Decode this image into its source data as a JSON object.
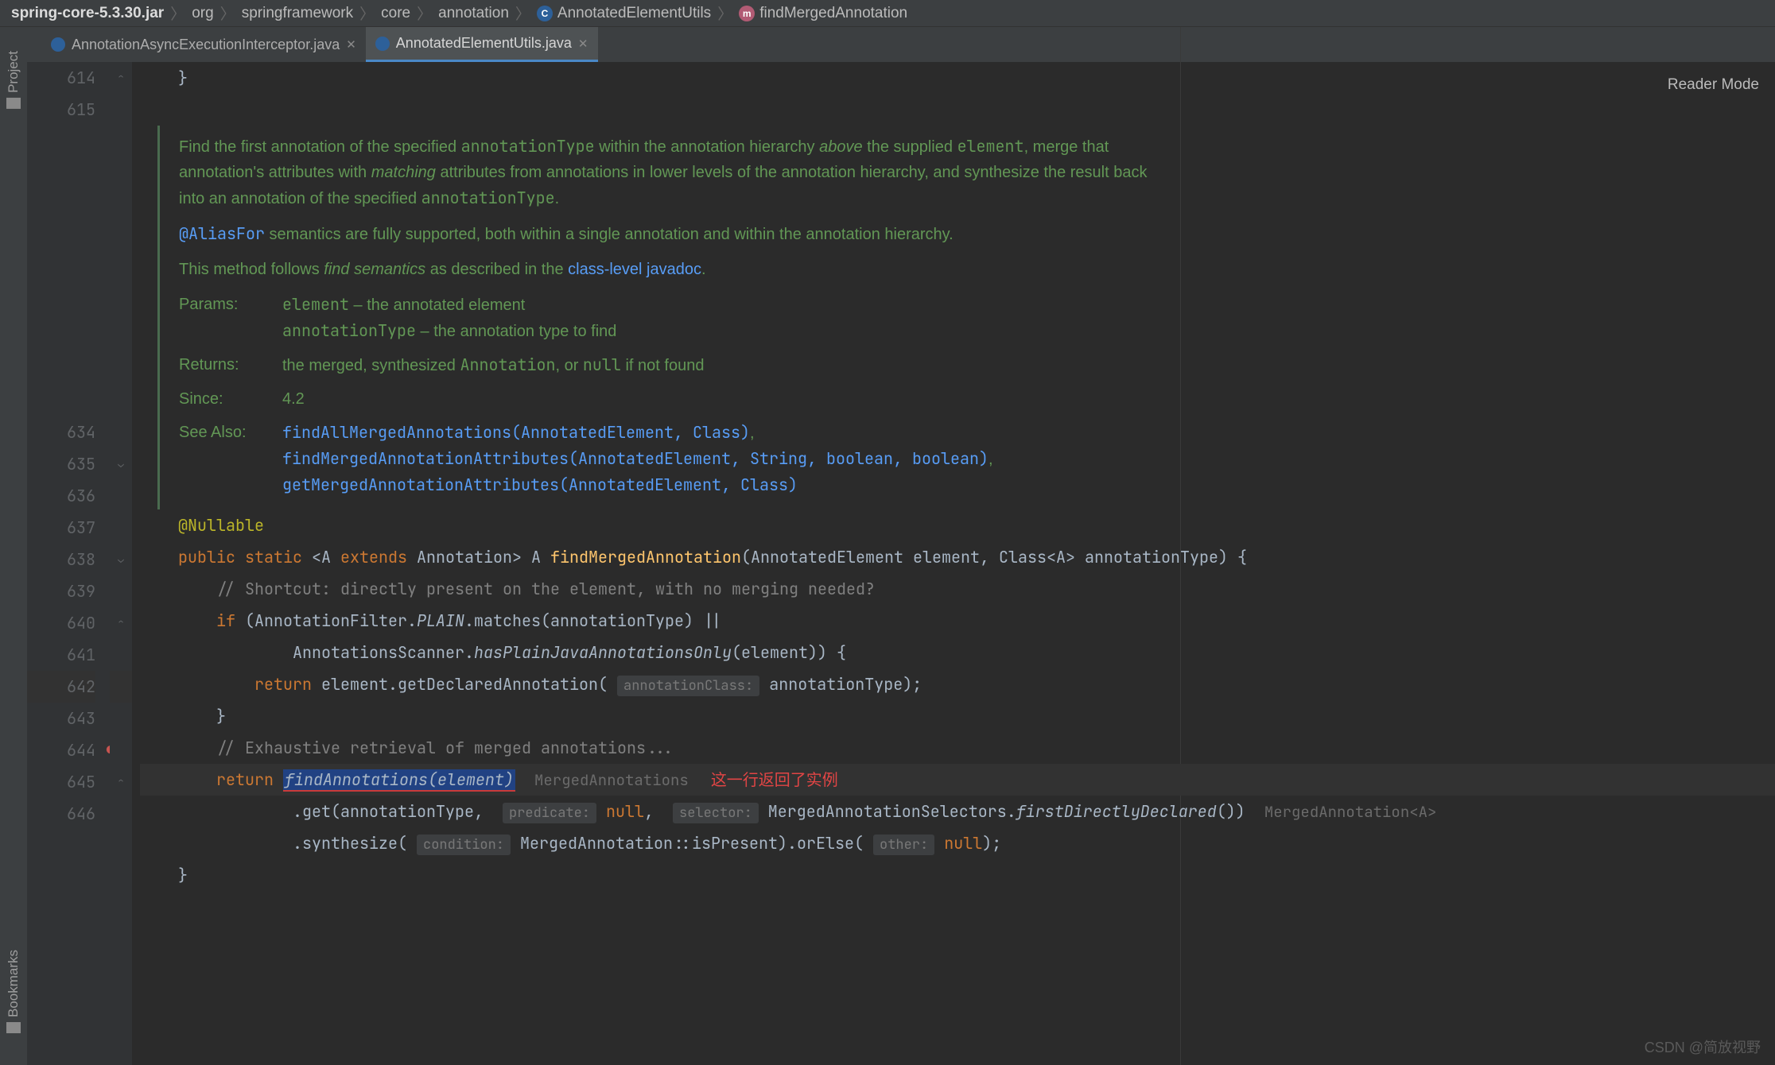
{
  "breadcrumbs": {
    "root": "spring-core-5.3.30.jar",
    "p1": "org",
    "p2": "springframework",
    "p3": "core",
    "p4": "annotation",
    "cls": "AnnotatedElementUtils",
    "method": "findMergedAnnotation"
  },
  "tabs": {
    "t1": "AnnotationAsyncExecutionInterceptor.java",
    "t2": "AnnotatedElementUtils.java"
  },
  "reader_mode": "Reader Mode",
  "left_rail": {
    "project": "Project",
    "bookmarks": "Bookmarks"
  },
  "gutter": {
    "l614": "614",
    "l615": "615",
    "l634": "634",
    "l635": "635",
    "l636": "636",
    "l637": "637",
    "l638": "638",
    "l639": "639",
    "l640": "640",
    "l641": "641",
    "l642": "642",
    "l643": "643",
    "l644": "644",
    "l645": "645",
    "l646": "646"
  },
  "doc": {
    "p1a": "Find the first annotation of the specified ",
    "p1b": " within the annotation hierarchy ",
    "p1c": " the supplied ",
    "p1d": ", merge that annotation's attributes with ",
    "p1e": " attributes from annotations in lower levels of the annotation hierarchy, and synthesize the result back into an annotation of the specified ",
    "p1f": ".",
    "ident_at": "annotationType",
    "above": "above",
    "element": "element",
    "matching": "matching",
    "alias": "@AliasFor",
    "p2a": " semantics are fully supported, both within a single annotation and within the annotation hierarchy.",
    "p3a": "This method follows ",
    "p3b": " as described in the ",
    "p3c": ".",
    "find_sem": "find semantics",
    "cls_jd": "class-level javadoc",
    "dt_params": "Params:",
    "dd_param1a": "element",
    "dd_param1b": " – the annotated element",
    "dd_param2a": "annotationType",
    "dd_param2b": " – the annotation type to find",
    "dt_returns": "Returns:",
    "dd_returns_a": "the merged, synthesized ",
    "dd_returns_b": "Annotation",
    "dd_returns_c": ", or ",
    "dd_returns_d": "null",
    "dd_returns_e": " if not found",
    "dt_since": "Since:",
    "dd_since": "4.2",
    "dt_see": "See Also:",
    "see1": "findAllMergedAnnotations(AnnotatedElement, Class)",
    "see2": "findMergedAnnotationAttributes(AnnotatedElement, String, boolean, boolean)",
    "see3": "getMergedAnnotationAttributes(AnnotatedElement, Class)"
  },
  "code": {
    "l614": "    }",
    "l634": "    @Nullable",
    "l635_a": "public static ",
    "l635_b": "<A ",
    "l635_c": "extends ",
    "l635_d": "Annotation> A ",
    "l635_e": "findMergedAnnotation",
    "l635_f": "(AnnotatedElement element, Class<A> annotationType) {",
    "l636": "        // Shortcut: directly present on the element, with no merging needed?",
    "l637_a": "if ",
    "l637_b": "(AnnotationFilter.",
    "l637_c": "PLAIN",
    "l637_d": ".matches(annotationType) ||",
    "l638_a": "                AnnotationsScanner.",
    "l638_b": "hasPlainJavaAnnotationsOnly",
    "l638_c": "(element)) {",
    "l639_a": "return ",
    "l639_b": "element.getDeclaredAnnotation(",
    "l639_hint": "annotationClass:",
    "l639_c": " annotationType);",
    "l640": "        }",
    "l641": "        // Exhaustive retrieval of merged annotations...",
    "l642_a": "return ",
    "l642_call": "findAnnotations(element)",
    "l642_inlay": "MergedAnnotations",
    "l642_note": "这一行返回了实例",
    "l643_a": "                .get(annotationType, ",
    "l643_h1": "predicate:",
    "l643_b": " null",
    "l643_c": ", ",
    "l643_h2": "selector:",
    "l643_d": " MergedAnnotationSelectors.",
    "l643_e": "firstDirectlyDeclared",
    "l643_f": "())",
    "l643_inlay": "MergedAnnotation<A>",
    "l644_a": "                .synthesize(",
    "l644_h1": "condition:",
    "l644_b": " MergedAnnotation::isPresent).orElse(",
    "l644_h2": "other:",
    "l644_c": " null",
    "l644_d": ");",
    "l645": "    }"
  },
  "watermark": "CSDN @简放视野"
}
